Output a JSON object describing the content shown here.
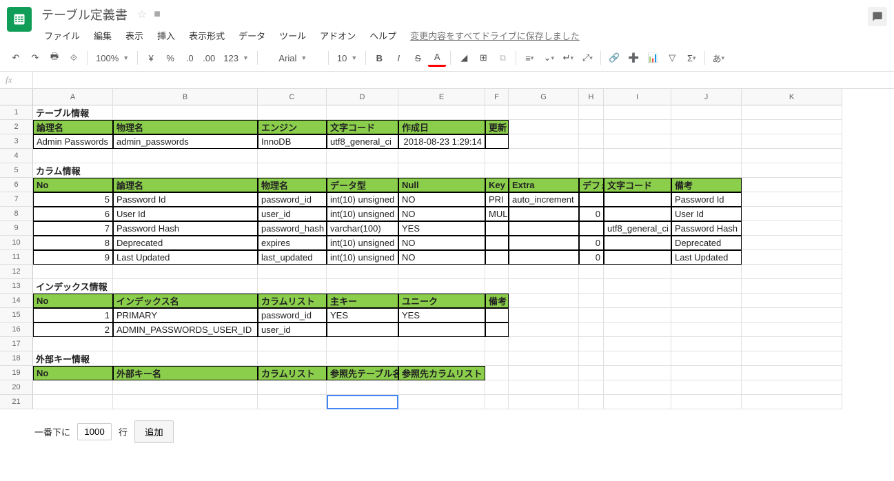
{
  "doc": {
    "title": "テーブル定義書"
  },
  "menus": [
    "ファイル",
    "編集",
    "表示",
    "挿入",
    "表示形式",
    "データ",
    "ツール",
    "アドオン",
    "ヘルプ"
  ],
  "save_status": "変更内容をすべてドライブに保存しました",
  "toolbar": {
    "zoom": "100%",
    "font": "Arial",
    "size": "10"
  },
  "columns": [
    "A",
    "B",
    "C",
    "D",
    "E",
    "F",
    "G",
    "H",
    "I",
    "J",
    "K"
  ],
  "rows": [
    {
      "n": 1,
      "cells": [
        "テーブル情報",
        "",
        "",
        "",
        "",
        "",
        "",
        "",
        "",
        "",
        ""
      ],
      "bold": [
        0
      ]
    },
    {
      "n": 2,
      "cls": "hdr",
      "span": 6,
      "cells": [
        "論理名",
        "物理名",
        "エンジン",
        "文字コード",
        "作成日",
        "更新日",
        "",
        "",
        "",
        "",
        ""
      ]
    },
    {
      "n": 3,
      "bd": 6,
      "cells": [
        "Admin Passwords",
        "admin_passwords",
        "InnoDB",
        "utf8_general_ci",
        "2018-08-23 1:29:14",
        "",
        "",
        "",
        "",
        "",
        ""
      ],
      "right": [
        4
      ]
    },
    {
      "n": 4,
      "cells": [
        "",
        "",
        "",
        "",
        "",
        "",
        "",
        "",
        "",
        "",
        ""
      ]
    },
    {
      "n": 5,
      "cells": [
        "カラム情報",
        "",
        "",
        "",
        "",
        "",
        "",
        "",
        "",
        "",
        ""
      ],
      "bold": [
        0
      ]
    },
    {
      "n": 6,
      "cls": "hdr",
      "span": 10,
      "cells": [
        "No",
        "論理名",
        "物理名",
        "データ型",
        "Null",
        "Key",
        "Extra",
        "デフォ",
        "文字コード",
        "備考",
        ""
      ]
    },
    {
      "n": 7,
      "bd": 10,
      "cells": [
        "5",
        "Password Id",
        "password_id",
        "int(10) unsigned",
        "NO",
        "PRI",
        "auto_increment",
        "",
        "",
        "Password Id",
        ""
      ],
      "right": [
        0
      ]
    },
    {
      "n": 8,
      "bd": 10,
      "cells": [
        "6",
        "User Id",
        "user_id",
        "int(10) unsigned",
        "NO",
        "MUL",
        "",
        "0",
        "",
        "User Id",
        ""
      ],
      "right": [
        0,
        7
      ]
    },
    {
      "n": 9,
      "bd": 10,
      "cells": [
        "7",
        "Password Hash",
        "password_hash",
        "varchar(100)",
        "YES",
        "",
        "",
        "",
        "utf8_general_ci",
        "Password Hash",
        ""
      ],
      "right": [
        0
      ]
    },
    {
      "n": 10,
      "bd": 10,
      "cells": [
        "8",
        "Deprecated",
        "expires",
        "int(10) unsigned",
        "NO",
        "",
        "",
        "0",
        "",
        "Deprecated",
        ""
      ],
      "right": [
        0,
        7
      ]
    },
    {
      "n": 11,
      "bd": 10,
      "cells": [
        "9",
        "Last Updated",
        "last_updated",
        "int(10) unsigned",
        "NO",
        "",
        "",
        "0",
        "",
        "Last Updated",
        ""
      ],
      "right": [
        0,
        7
      ]
    },
    {
      "n": 12,
      "cells": [
        "",
        "",
        "",
        "",
        "",
        "",
        "",
        "",
        "",
        "",
        ""
      ]
    },
    {
      "n": 13,
      "cells": [
        "インデックス情報",
        "",
        "",
        "",
        "",
        "",
        "",
        "",
        "",
        "",
        ""
      ],
      "bold": [
        0
      ]
    },
    {
      "n": 14,
      "cls": "hdr",
      "span": 6,
      "cells": [
        "No",
        "インデックス名",
        "カラムリスト",
        "主キー",
        "ユニーク",
        "備考",
        "",
        "",
        "",
        "",
        ""
      ]
    },
    {
      "n": 15,
      "bd": 6,
      "cells": [
        "1",
        "PRIMARY",
        "password_id",
        "YES",
        "YES",
        "",
        "",
        "",
        "",
        "",
        ""
      ],
      "right": [
        0
      ]
    },
    {
      "n": 16,
      "bd": 6,
      "cells": [
        "2",
        "ADMIN_PASSWORDS_USER_ID",
        "user_id",
        "",
        "",
        "",
        "",
        "",
        "",
        "",
        ""
      ],
      "right": [
        0
      ]
    },
    {
      "n": 17,
      "cells": [
        "",
        "",
        "",
        "",
        "",
        "",
        "",
        "",
        "",
        "",
        ""
      ]
    },
    {
      "n": 18,
      "cells": [
        "外部キー情報",
        "",
        "",
        "",
        "",
        "",
        "",
        "",
        "",
        "",
        ""
      ],
      "bold": [
        0
      ]
    },
    {
      "n": 19,
      "cls": "hdr",
      "span": 5,
      "cells": [
        "No",
        "外部キー名",
        "カラムリスト",
        "参照先テーブル名",
        "参照先カラムリスト",
        "",
        "",
        "",
        "",
        "",
        ""
      ]
    },
    {
      "n": 20,
      "cells": [
        "",
        "",
        "",
        "",
        "",
        "",
        "",
        "",
        "",
        "",
        ""
      ]
    },
    {
      "n": 21,
      "cells": [
        "",
        "",
        "",
        "",
        "",
        "",
        "",
        "",
        "",
        "",
        ""
      ],
      "sel": 3
    }
  ],
  "footer": {
    "prefix": "一番下に",
    "value": "1000",
    "suffix": "行",
    "btn": "追加"
  }
}
